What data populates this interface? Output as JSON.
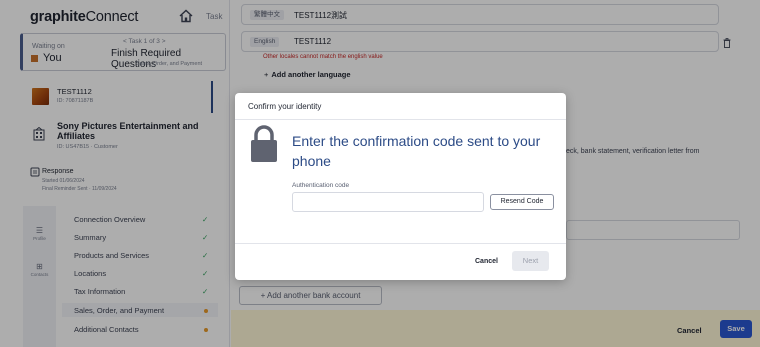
{
  "app": {
    "logo_bold": "graphite",
    "logo_light": "Connect",
    "tasks_label": "Task"
  },
  "waiting": {
    "waiting_on": "Waiting on",
    "you": "You",
    "task_of": "Task 1 of 3",
    "title": "Finish Required Questions",
    "subtitle": "Sales, Order, and Payment"
  },
  "entity": {
    "name": "TEST1112",
    "id": "ID: 70871187B"
  },
  "company": {
    "name": "Sony Pictures Entertainment and Affiliates",
    "id": "ID: US47B15 · Customer"
  },
  "response": {
    "label": "Response",
    "started": "Started 01/06/2024",
    "reminder": "Final Reminder Sent · 11/09/2024"
  },
  "tools": [
    {
      "label": "Profile"
    },
    {
      "label": "Contacts"
    }
  ],
  "nav": [
    {
      "label": "Connection Overview",
      "status": "done"
    },
    {
      "label": "Summary",
      "status": "done"
    },
    {
      "label": "Products and Services",
      "status": "done"
    },
    {
      "label": "Locations",
      "status": "done"
    },
    {
      "label": "Tax Information",
      "status": "done"
    },
    {
      "label": "Sales, Order, and Payment",
      "status": "pending"
    },
    {
      "label": "Additional Contacts",
      "status": "pending"
    }
  ],
  "main": {
    "lang_rows": [
      {
        "badge": "繁體中文",
        "value": "TEST1112測試"
      },
      {
        "badge": "English",
        "value": "TEST1112"
      }
    ],
    "error_text": "Other locales cannot match the english value",
    "add_language": "Add another language",
    "bg_text": "eck, bank statement, verification letter from",
    "add_bank": "+ Add another bank account",
    "cancel": "Cancel",
    "save": "Save"
  },
  "modal": {
    "title": "Confirm your identity",
    "heading": "Enter the confirmation code sent to your phone",
    "auth_label": "Authentication code",
    "auth_value": "",
    "resend": "Resend Code",
    "cancel": "Cancel",
    "next": "Next"
  },
  "colors": {
    "accent": "#2c4b86",
    "save_button": "#2a57d1",
    "error": "#c62828",
    "bottom_bar": "#fff8d8",
    "success_check": "#2e9f5a",
    "pending_dot": "#e89a2a"
  },
  "icons": [
    "home-icon",
    "lock-icon",
    "trash-icon",
    "company-icon",
    "response-icon",
    "check-icon"
  ]
}
